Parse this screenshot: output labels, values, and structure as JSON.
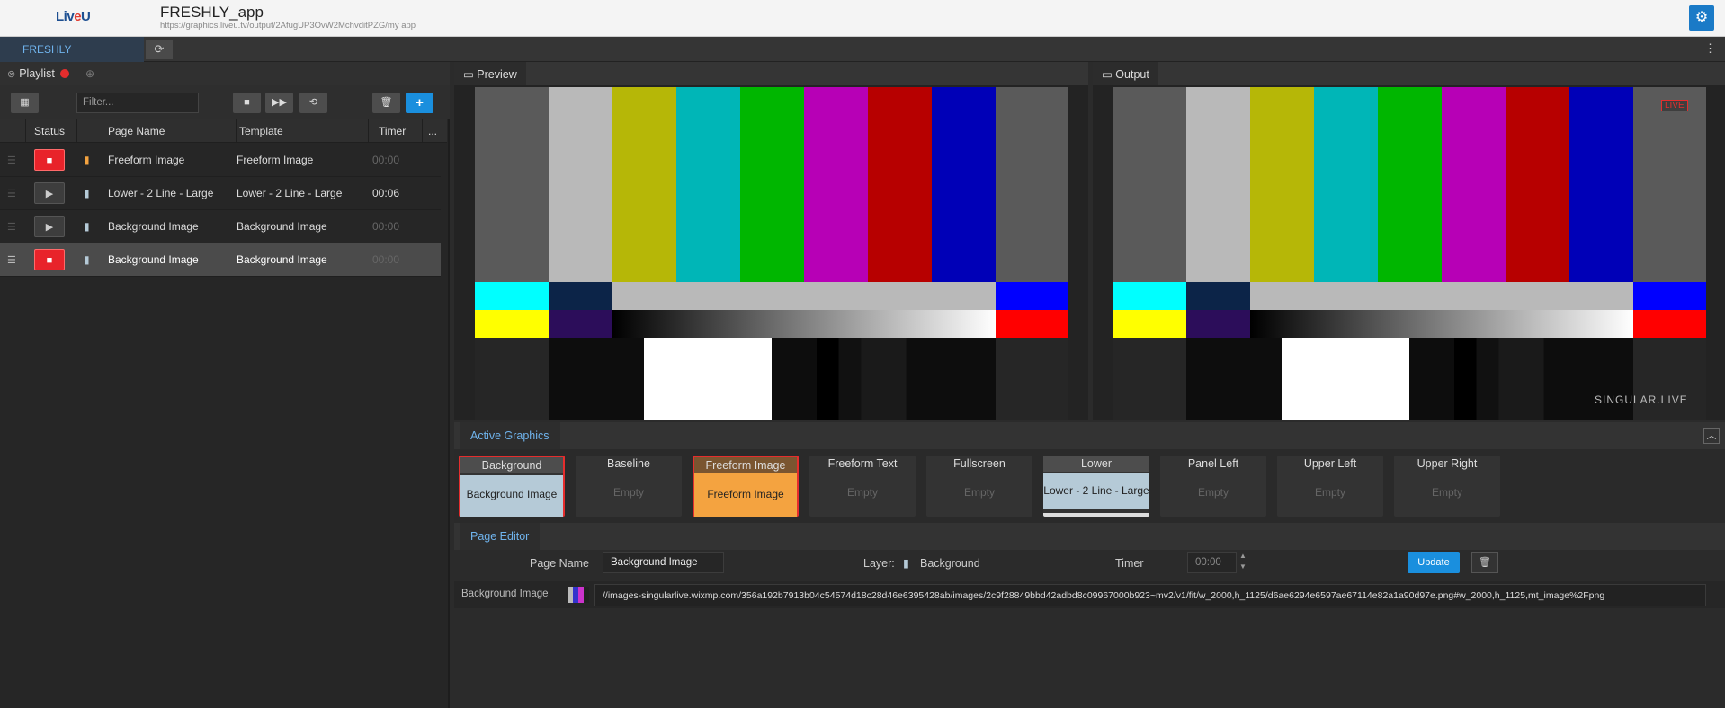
{
  "header": {
    "logo": "LiveU",
    "title": "FRESHLY_app",
    "url": "https://graphics.liveu.tv/output/2AfugUP3OvW2MchvditPZG/my app"
  },
  "tabs": {
    "active": "FRESHLY"
  },
  "playlist": {
    "title": "Playlist",
    "filter_placeholder": "Filter...",
    "columns": [
      "Status",
      "Page Name",
      "Template",
      "Timer",
      "..."
    ],
    "rows": [
      {
        "status": "stop",
        "page": "Freeform Image",
        "template": "Freeform Image",
        "timer": "00:00"
      },
      {
        "status": "play",
        "page": "Lower - 2 Line - Large",
        "template": "Lower - 2 Line - Large",
        "timer": "00:06"
      },
      {
        "status": "play",
        "page": "Background Image",
        "template": "Background Image",
        "timer": "00:00"
      },
      {
        "status": "stop",
        "page": "Background Image",
        "template": "Background Image",
        "timer": "00:00"
      }
    ]
  },
  "preview": {
    "title": "Preview"
  },
  "output": {
    "title": "Output",
    "live_badge": "LIVE",
    "watermark": "SINGULAR.LIVE"
  },
  "active_graphics": {
    "title": "Active Graphics",
    "layers": [
      {
        "name": "Background",
        "value": "Background Image"
      },
      {
        "name": "Baseline",
        "value": "Empty"
      },
      {
        "name": "Freeform Image",
        "value": "Freeform Image"
      },
      {
        "name": "Freeform Text",
        "value": "Empty"
      },
      {
        "name": "Fullscreen",
        "value": "Empty"
      },
      {
        "name": "Lower",
        "value": "Lower - 2 Line - Large"
      },
      {
        "name": "Panel Left",
        "value": "Empty"
      },
      {
        "name": "Upper Left",
        "value": "Empty"
      },
      {
        "name": "Upper Right",
        "value": "Empty"
      }
    ]
  },
  "page_editor": {
    "title": "Page Editor",
    "page_name_label": "Page Name",
    "page_name_value": "Background Image",
    "layer_label": "Layer:",
    "layer_value": "Background",
    "timer_label": "Timer",
    "timer_value": "00:00",
    "update_label": "Update",
    "field_label": "Background Image",
    "field_value": "//images-singularlive.wixmp.com/356a192b7913b04c54574d18c28d46e6395428ab/images/2c9f28849bbd42adbd8c09967000b923~mv2/v1/fit/w_2000,h_1125/d6ae6294e6597ae67114e82a1a90d97e.png#w_2000,h_1125,mt_image%2Fpng"
  },
  "colors": {
    "accent": "#1a8fde",
    "stop": "#e8232a",
    "freeform": "#f4a340",
    "layer_active": "#b5cad7"
  },
  "icons": [
    "gear-icon",
    "refresh-icon",
    "grid-icon",
    "stop-icon",
    "fast-forward-icon",
    "loop-icon",
    "trash-icon",
    "plus-icon",
    "play-icon",
    "file-icon",
    "drag-handle-icon",
    "window-icon",
    "chevron-up-icon",
    "kebab-icon"
  ]
}
